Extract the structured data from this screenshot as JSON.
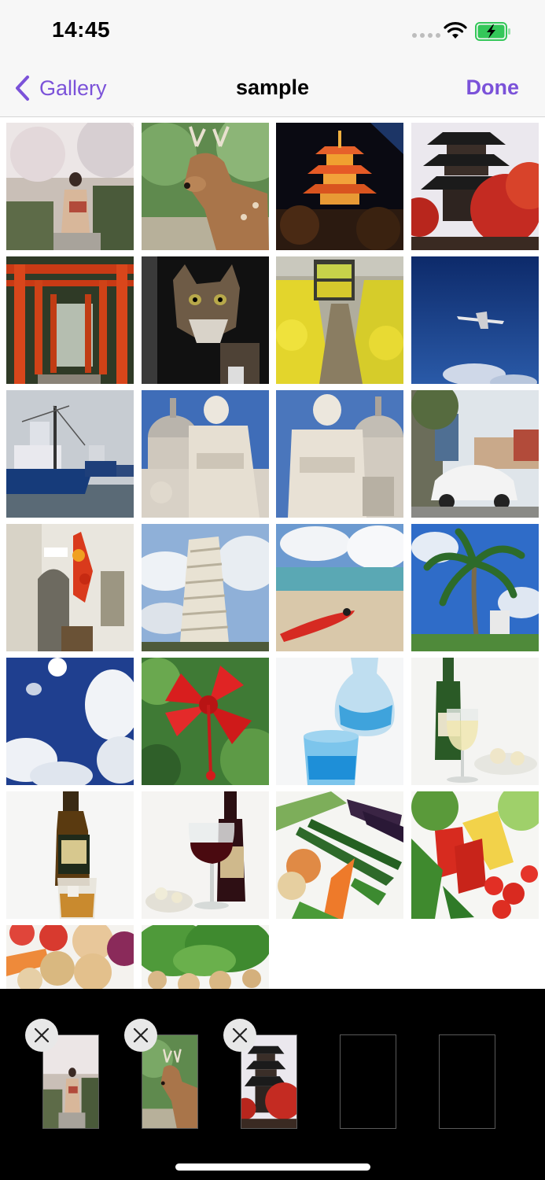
{
  "status_bar": {
    "time": "14:45"
  },
  "nav": {
    "back_label": "Gallery",
    "title": "sample",
    "done_label": "Done"
  },
  "grid": {
    "photos": [
      "kimono-cherry-blossom-path",
      "deer",
      "illuminated-pagoda-night",
      "pagoda-autumn-maples",
      "torii-gates",
      "tabby-cat",
      "train-rapeseed-field",
      "airplane-blue-sky",
      "fishing-boats-harbor",
      "statue-dome-1",
      "statue-dome-2",
      "beetle-car-street",
      "alley-peppers",
      "leaning-tower-pisa",
      "beach-red-kayak",
      "palm-tree-hotel",
      "sun-clouds-sky",
      "red-hibiscus",
      "blue-glass-carafe",
      "white-wine-cheese",
      "whisky-bottle-glass",
      "red-wine-glass",
      "vegetables-cucumber-eggplant",
      "vegetables-pepper-corn",
      "vegetables-potato-onion",
      "vegetables-lettuce"
    ]
  },
  "tray": {
    "selected": [
      "kimono-cherry-blossom-path",
      "deer",
      "pagoda-autumn-maples"
    ],
    "slot_count": 5
  }
}
